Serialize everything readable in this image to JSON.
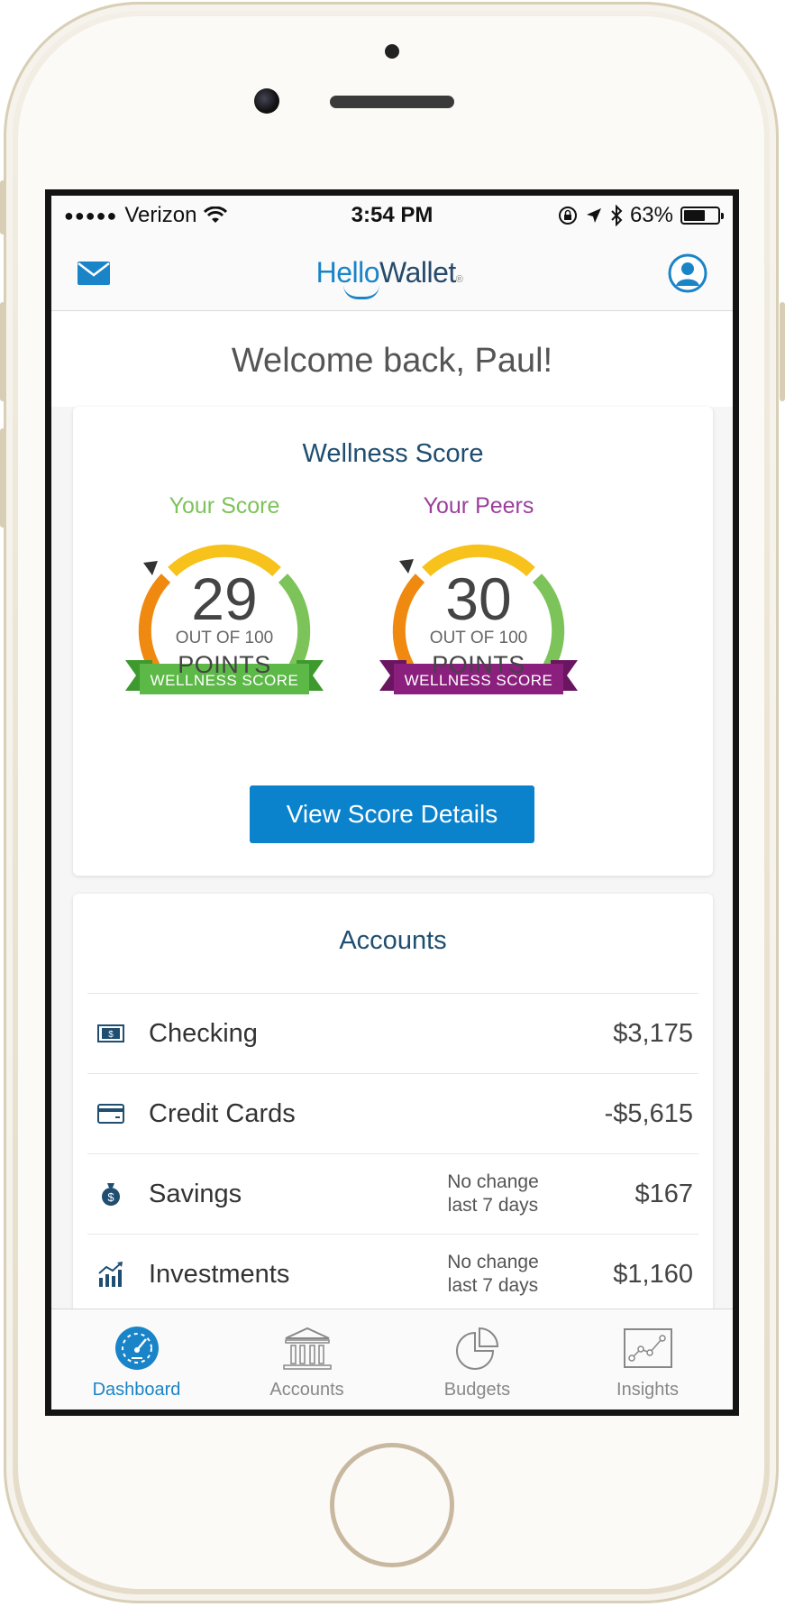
{
  "status_bar": {
    "signal_dots": "●●●●●",
    "carrier": "Verizon",
    "time": "3:54 PM",
    "battery_percent": "63%",
    "battery_level": 0.63
  },
  "header": {
    "brand_part1": "Hello",
    "brand_part2": "Wallet",
    "brand_mark": "®"
  },
  "welcome": "Welcome back, Paul!",
  "wellness": {
    "title": "Wellness Score",
    "yours": {
      "label": "Your Score",
      "score": "29",
      "out_of": "OUT OF 100",
      "unit": "POINTS",
      "ribbon": "WELLNESS SCORE",
      "label_color": "#7cc35a",
      "ribbon_color": "#5cb947"
    },
    "peers": {
      "label": "Your Peers",
      "score": "30",
      "out_of": "OUT OF 100",
      "unit": "POINTS",
      "ribbon": "WELLNESS SCORE",
      "label_color": "#9b3f9b",
      "ribbon_color": "#8b1f7e"
    },
    "button": "View Score Details"
  },
  "accounts": {
    "title": "Accounts",
    "rows": [
      {
        "icon": "cash-icon",
        "name": "Checking",
        "note_line1": "",
        "note_line2": "",
        "amount": "$3,175"
      },
      {
        "icon": "credit-card-icon",
        "name": "Credit Cards",
        "note_line1": "",
        "note_line2": "",
        "amount": "-$5,615"
      },
      {
        "icon": "money-bag-icon",
        "name": "Savings",
        "note_line1": "No change",
        "note_line2": "last 7 days",
        "amount": "$167"
      },
      {
        "icon": "growth-chart-icon",
        "name": "Investments",
        "note_line1": "No change",
        "note_line2": "last 7 days",
        "amount": "$1,160"
      }
    ]
  },
  "tabs": [
    {
      "label": "Dashboard",
      "icon": "dashboard-icon",
      "active": true
    },
    {
      "label": "Accounts",
      "icon": "bank-icon",
      "active": false
    },
    {
      "label": "Budgets",
      "icon": "pie-chart-icon",
      "active": false
    },
    {
      "label": "Insights",
      "icon": "line-chart-icon",
      "active": false
    }
  ],
  "colors": {
    "accent": "#0a82cc",
    "title": "#1f4e70",
    "gauge_orange": "#f0890f",
    "gauge_yellow": "#f7c21b",
    "gauge_green": "#7cc35a"
  }
}
